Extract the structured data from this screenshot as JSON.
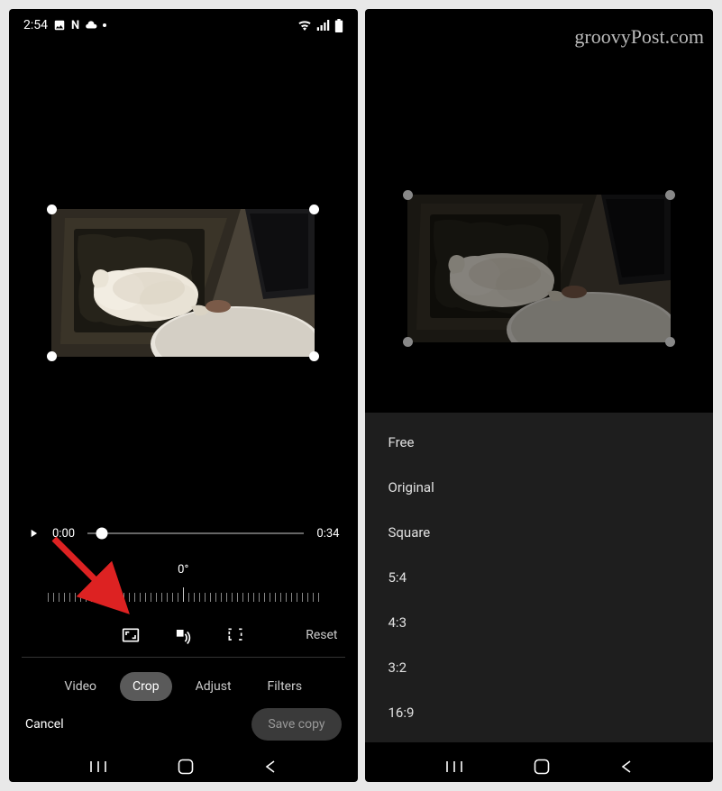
{
  "watermark": "groovyPost.com",
  "status": {
    "time": "2:54",
    "icons_left": [
      "image-icon",
      "netflix-icon",
      "cloud-icon",
      "dot-icon"
    ],
    "icons_right": [
      "wifi-icon",
      "signal-icon",
      "battery-icon"
    ]
  },
  "playback": {
    "current_time": "0:00",
    "duration": "0:34"
  },
  "rotation": {
    "angle_label": "0°"
  },
  "crop_tools": {
    "aspect_button": "aspect-ratio-icon",
    "rotate_button": "rotate-icon",
    "free_crop_button": "free-crop-icon",
    "reset_label": "Reset"
  },
  "tabs": [
    "Video",
    "Crop",
    "Adjust",
    "Filters"
  ],
  "active_tab": "Crop",
  "actions": {
    "cancel_label": "Cancel",
    "save_label": "Save copy"
  },
  "aspect_options": [
    "Free",
    "Original",
    "Square",
    "5:4",
    "4:3",
    "3:2",
    "16:9"
  ]
}
